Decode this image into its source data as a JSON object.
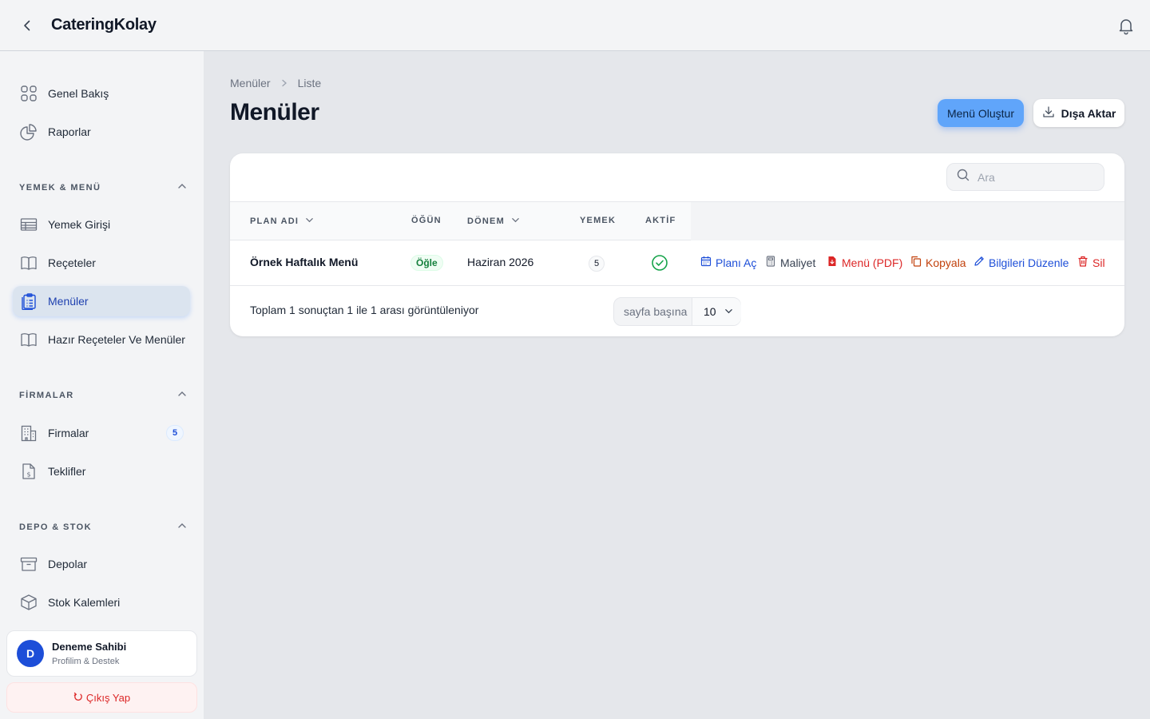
{
  "header": {
    "app_title": "CateringKolay",
    "back_icon": "chevron-left-icon",
    "notification_icon": "bell-icon"
  },
  "sidebar": {
    "top_items": [
      {
        "label": "Genel Bakış",
        "icon": "grid-icon"
      },
      {
        "label": "Raporlar",
        "icon": "pie-chart-icon"
      }
    ],
    "sections": [
      {
        "title": "YEMEK & MENÜ",
        "items": [
          {
            "label": "Yemek Girişi",
            "icon": "table-icon"
          },
          {
            "label": "Reçeteler",
            "icon": "book-icon"
          },
          {
            "label": "Menüler",
            "icon": "clipboard-list-icon",
            "active": true
          },
          {
            "label": "Hazır Reçeteler Ve Menüler",
            "icon": "book-icon"
          }
        ]
      },
      {
        "title": "FİRMALAR",
        "items": [
          {
            "label": "Firmalar",
            "icon": "building-icon",
            "badge": "5"
          },
          {
            "label": "Teklifler",
            "icon": "document-dollar-icon"
          }
        ]
      },
      {
        "title": "DEPO & STOK",
        "items": [
          {
            "label": "Depolar",
            "icon": "archive-icon"
          },
          {
            "label": "Stok Kalemleri",
            "icon": "cube-icon"
          }
        ]
      }
    ],
    "user": {
      "initial": "D",
      "name": "Deneme Sahibi",
      "subtitle": "Profilim & Destek"
    },
    "logout_label": "Çıkış Yap"
  },
  "main": {
    "breadcrumb": [
      "Menüler",
      "Liste"
    ],
    "title": "Menüler",
    "create_button": "Menü Oluştur",
    "export_button": "Dışa Aktar",
    "search_placeholder": "Ara",
    "table": {
      "columns": [
        "PLAN ADI",
        "ÖĞÜN",
        "DÖNEM",
        "YEMEK",
        "AKTİF"
      ],
      "rows": [
        {
          "plan_name": "Örnek Haftalık Menü",
          "meal": "Öğle",
          "period": "Haziran 2026",
          "dish_count": "5",
          "active": true,
          "actions": [
            "Planı Aç",
            "Maliyet",
            "Menü (PDF)",
            "Kopyala",
            "Bilgileri Düzenle",
            "Sil"
          ]
        }
      ]
    },
    "footer": {
      "summary": "Toplam 1 sonuçtan 1 ile 1 arası görüntüleniyor",
      "per_page_label": "sayfa başına",
      "per_page_value": "10"
    }
  },
  "colors": {
    "primary": "#60a5fa",
    "link_blue": "#1d4ed8",
    "danger": "#dc2626",
    "warning": "#c2410c",
    "success": "#16a34a"
  }
}
